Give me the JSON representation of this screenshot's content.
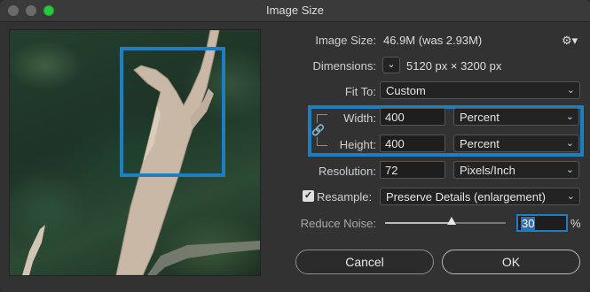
{
  "window": {
    "title": "Image Size"
  },
  "image_size": {
    "label": "Image Size:",
    "value": "46.9M (was 2.93M)"
  },
  "dimensions": {
    "label": "Dimensions:",
    "value": "5120 px  ×  3200 px"
  },
  "fit_to": {
    "label": "Fit To:",
    "value": "Custom"
  },
  "width": {
    "label": "Width:",
    "value": "400",
    "unit": "Percent"
  },
  "height": {
    "label": "Height:",
    "value": "400",
    "unit": "Percent"
  },
  "resolution": {
    "label": "Resolution:",
    "value": "72",
    "unit": "Pixels/Inch"
  },
  "resample": {
    "label": "Resample:",
    "checked": true,
    "method": "Preserve Details (enlargement)"
  },
  "reduce_noise": {
    "label": "Reduce Noise:",
    "value": "30",
    "unit": "%",
    "slider_fraction": 0.55
  },
  "buttons": {
    "cancel": "Cancel",
    "ok": "OK"
  },
  "icons": {
    "settings": "gear-icon",
    "link": "chain-link-icon",
    "dimensions_toggle": "chevron-down-icon"
  },
  "colors": {
    "highlight": "#1c7fc4",
    "zoom_green": "#28c840"
  }
}
